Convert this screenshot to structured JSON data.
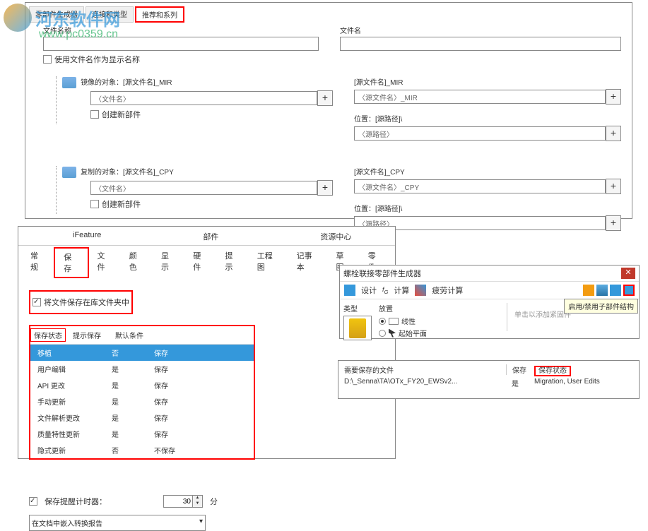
{
  "watermark": {
    "text1": "河东软件网",
    "text2": "www.pc0359.cn"
  },
  "panel1": {
    "tabs": [
      "零部件生成器",
      "连接和类型",
      "推荐和系列"
    ],
    "filename_label": "文件名称",
    "filename_label2": "文件名",
    "use_filename_check": "使用文件名作为显示名称",
    "mirror": {
      "label": "镜像的对象：[源文件名]_MIR",
      "value": "〈文件名〉",
      "create_new": "创建新部件",
      "right_label": "[源文件名]_MIR",
      "right_value": "〈源文件名〉_MIR",
      "location_label": "位置：[源路径]\\",
      "location_value": "〈源路径〉"
    },
    "copy": {
      "label": "复制的对象：[源文件名]_CPY",
      "value": "〈文件名〉",
      "create_new": "创建新部件",
      "right_label": "[源文件名]_CPY",
      "right_value": "〈源文件名〉_CPY",
      "location_label": "位置：[源路径]\\",
      "location_value": "〈源路径〉"
    }
  },
  "panel2": {
    "tabs_row1": [
      "iFeature",
      "部件",
      "资源中心"
    ],
    "tabs_row2": [
      "常规",
      "保存",
      "文件",
      "颜色",
      "显示",
      "硬件",
      "提示",
      "工程图",
      "记事本",
      "草图",
      "零件"
    ],
    "save_in_lib": "将文件保存在库文件夹中",
    "table": {
      "headers": [
        "保存状态",
        "提示保存",
        "默认条件"
      ],
      "rows": [
        {
          "c1": "移植",
          "c2": "否",
          "c3": "保存",
          "selected": true
        },
        {
          "c1": "用户编辑",
          "c2": "是",
          "c3": "保存",
          "selected": false
        },
        {
          "c1": "API 更改",
          "c2": "是",
          "c3": "保存",
          "selected": false
        },
        {
          "c1": "手动更新",
          "c2": "是",
          "c3": "保存",
          "selected": false
        },
        {
          "c1": "文件解析更改",
          "c2": "是",
          "c3": "保存",
          "selected": false
        },
        {
          "c1": "质量特性更新",
          "c2": "是",
          "c3": "保存",
          "selected": false
        },
        {
          "c1": "隐式更新",
          "c2": "否",
          "c3": "不保存",
          "selected": false
        }
      ]
    },
    "reminder": {
      "label": "保存提醒计时器：",
      "value": "30",
      "unit": "分"
    },
    "report": "在文档中嵌入转换报告"
  },
  "panel3": {
    "title": "螺栓联接零部件生成器",
    "tb_design": "设计",
    "tb_calc": "计算",
    "tb_fatigue": "疲劳计算",
    "tooltip": "启用/禁用子部件结构",
    "col_type": "类型",
    "col_place": "放置",
    "opt_linear": "线性",
    "opt_startplane": "起始平面",
    "hint": "单击以添加紧固件"
  },
  "panel4": {
    "h1": "需要保存的文件",
    "h2": "保存",
    "h3": "保存状态",
    "c1": "D:\\_Senna\\TA\\OTx_FY20_EWSv2...",
    "c2": "是",
    "c3": "Migration, User Edits"
  }
}
